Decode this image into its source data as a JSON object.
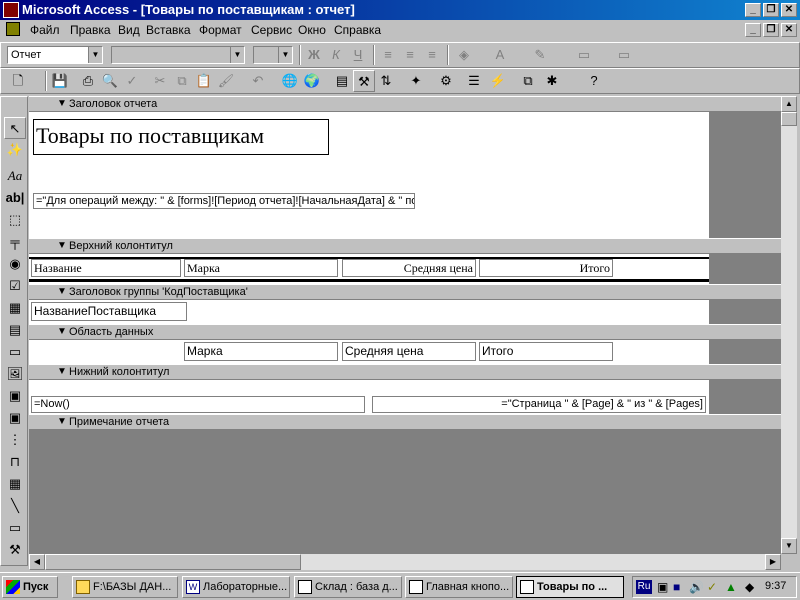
{
  "window": {
    "title": "Microsoft Access - [Товары по поставщикам : отчет]"
  },
  "menu": [
    "Файл",
    "Правка",
    "Вид",
    "Вставка",
    "Формат",
    "Сервис",
    "Окно",
    "Справка"
  ],
  "format_toolbar": {
    "object_combo": "Отчет",
    "font_combo": "",
    "size_combo": "",
    "bold": "Ж",
    "italic": "К",
    "underline": "Ч"
  },
  "report": {
    "sections": {
      "report_header": "Заголовок отчета",
      "page_header": "Верхний колонтитул",
      "group_header": "Заголовок группы 'КодПоставщика'",
      "detail": "Область данных",
      "page_footer": "Нижний колонтитул",
      "report_footer": "Примечание отчета"
    },
    "title_label": "Товары по поставщикам",
    "filter_expr": "=\"Для операций между: \" & [forms]![Период отчета]![НачальнаяДата] & \" по",
    "page_header_labels": [
      "Название",
      "Марка",
      "Средняя цена",
      "Итого"
    ],
    "group_field": "НазваниеПоставщика",
    "detail_fields": [
      "Марка",
      "Средняя цена",
      "Итого"
    ],
    "now_expr": "=Now()",
    "page_expr": "=\"Страница \" & [Page] & \" из \" & [Pages]"
  },
  "taskbar": {
    "start": "Пуск",
    "tasks": [
      "F:\\БАЗЫ ДАН...",
      "Лабораторные...",
      "Склад : база д...",
      "Главная кнопо...",
      "Товары по ..."
    ],
    "lang": "Ru",
    "clock": "9:37"
  }
}
